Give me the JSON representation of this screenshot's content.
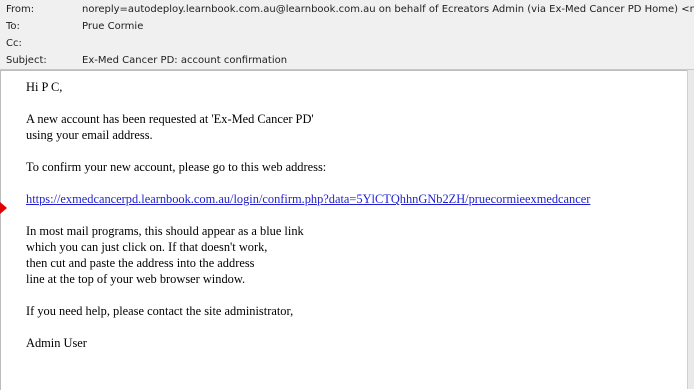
{
  "header": {
    "from_label": "From:",
    "from_value": "noreply=autodeploy.learnbook.com.au@learnbook.com.au on behalf of Ecreators Admin (via Ex-Med Cancer PD Home) <noreply@autodeploy.learnbook.com.au>",
    "to_label": "To:",
    "to_value": "Prue Cormie",
    "cc_label": "Cc:",
    "cc_value": "",
    "subject_label": "Subject:",
    "subject_value": "Ex-Med Cancer PD: account confirmation"
  },
  "message": {
    "greeting": "Hi P C,",
    "para1_line1": "A new account has been requested at 'Ex-Med Cancer PD'",
    "para1_line2": "using your email address.",
    "para2": "To confirm your new account, please go to this web address:",
    "link": "https://exmedcancerpd.learnbook.com.au/login/confirm.php?data=5YlCTQhhnGNb2ZH/pruecormieexmedcancer",
    "para4_line1": "In most mail programs, this should appear as a blue link",
    "para4_line2": "which you can just click on. If that doesn't work,",
    "para4_line3": "then cut and paste the address into the address",
    "para4_line4": "line at the top of your web browser window.",
    "para5": "If you need help, please contact the site administrator,",
    "signature": "Admin User"
  },
  "colors": {
    "link": "#1f1fd0",
    "annotation_arrow": "#e00000",
    "header_bg": "#f0f0f0"
  }
}
